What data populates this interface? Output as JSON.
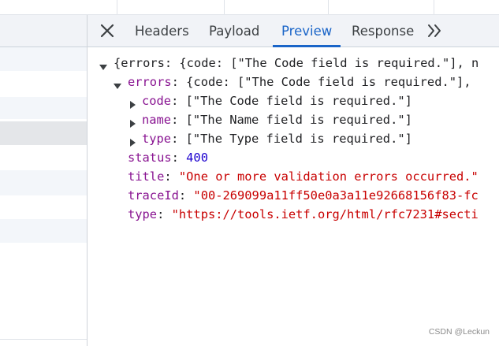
{
  "tabs": [
    {
      "label": "Headers"
    },
    {
      "label": "Payload"
    },
    {
      "label": "Preview"
    },
    {
      "label": "Response"
    }
  ],
  "icons": {
    "close": "close-icon",
    "more": "chevron-double-right-icon",
    "expanded": "triangle-down-icon",
    "collapsed": "triangle-right-icon"
  },
  "colors": {
    "accent": "#1a65c8",
    "key": "#881391",
    "string": "#c80000",
    "number": "#1c00cf",
    "selected_row": "#e4e6e9",
    "striped_row": "#f3f6fa"
  },
  "tree": {
    "root_summary": "{errors: {code: [\"The Code field is required.\"], n",
    "errors": {
      "key": "errors",
      "summary": "{code: [\"The Code field is required.\"],",
      "code": {
        "key": "code",
        "value": "[\"The Code field is required.\"]"
      },
      "name": {
        "key": "name",
        "value": "[\"The Name field is required.\"]"
      },
      "type": {
        "key": "type",
        "value": "[\"The Type field is required.\"]"
      }
    },
    "status": {
      "key": "status",
      "value": "400"
    },
    "title": {
      "key": "title",
      "value": "\"One or more validation errors occurred.\""
    },
    "traceId": {
      "key": "traceId",
      "value": "\"00-269099a11ff50e0a3a11e92668156f83-fc"
    },
    "type": {
      "key": "type",
      "value": "\"https://tools.ietf.org/html/rfc7231#secti"
    }
  },
  "watermark": "CSDN @Leckun"
}
